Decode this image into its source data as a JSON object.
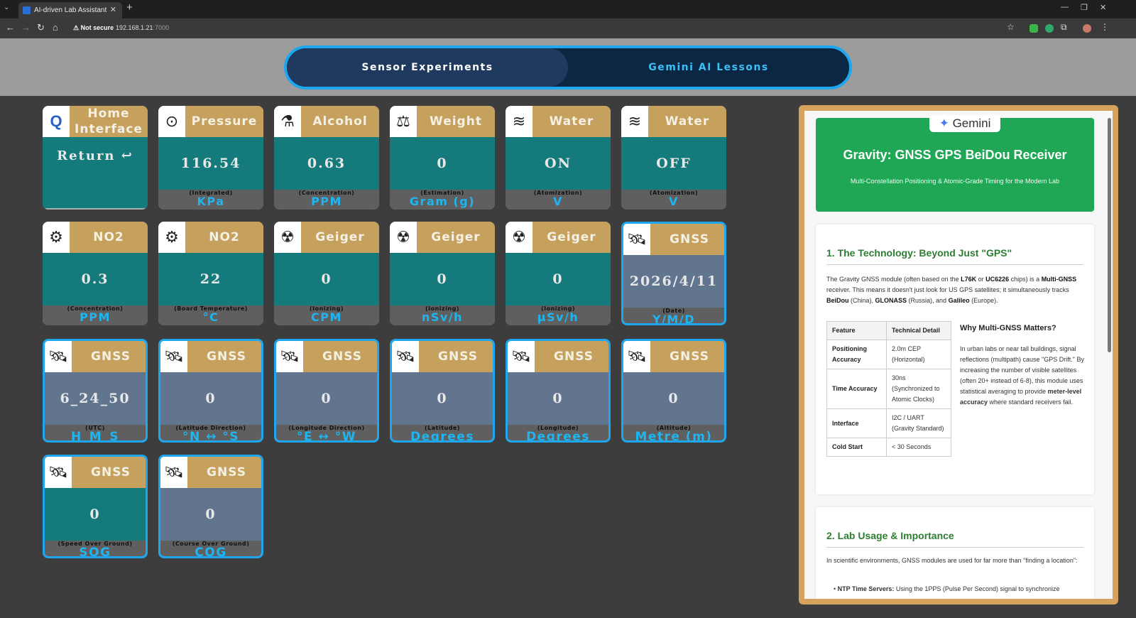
{
  "browser": {
    "tab_title": "AI-driven Lab Assistant",
    "tab_close": "✕",
    "new_tab": "+",
    "not_secure": "Not secure",
    "url_host": "192.168.1.21",
    "url_port": ":7000"
  },
  "switcher": {
    "left_label": "Sensor Experiments",
    "right_label": "Gemini AI Lessons"
  },
  "cards": [
    {
      "title": "Home Interface",
      "value": "Return ↩",
      "desc": "",
      "unit": ""
    },
    {
      "title": "Pressure",
      "value": "116.54",
      "desc": "(Integrated)",
      "unit": "KPa"
    },
    {
      "title": "Alcohol",
      "value": "0.63",
      "desc": "(Concentration)",
      "unit": "PPM"
    },
    {
      "title": "Weight",
      "value": "0",
      "desc": "(Estimation)",
      "unit": "Gram (g)"
    },
    {
      "title": "Water",
      "value": "ON",
      "desc": "(Atomization)",
      "unit": "V"
    },
    {
      "title": "Water",
      "value": "OFF",
      "desc": "(Atomization)",
      "unit": "V"
    },
    {
      "title": "NO2",
      "value": "0.3",
      "desc": "(Concentration)",
      "unit": "PPM"
    },
    {
      "title": "NO2",
      "value": "22",
      "desc": "(Board Temperature)",
      "unit": "°C"
    },
    {
      "title": "Geiger",
      "value": "0",
      "desc": "(Ionizing)",
      "unit": "CPM"
    },
    {
      "title": "Geiger",
      "value": "0",
      "desc": "(Ionizing)",
      "unit": "nSv/h"
    },
    {
      "title": "Geiger",
      "value": "0",
      "desc": "(Ionizing)",
      "unit": "μSv/h"
    },
    {
      "title": "GNSS",
      "value": "2026/4/11",
      "desc": "(Date)",
      "unit": "Y/M/D"
    },
    {
      "title": "GNSS",
      "value": "6_24_50",
      "desc": "(UTC)",
      "unit": "H_M_S"
    },
    {
      "title": "GNSS",
      "value": "0",
      "desc": "(Latitude Direction)",
      "unit": "°N ↔ °S"
    },
    {
      "title": "GNSS",
      "value": "0",
      "desc": "(Longitude Direction)",
      "unit": "°E ↔ °W"
    },
    {
      "title": "GNSS",
      "value": "0",
      "desc": "(Latitude)",
      "unit": "Degrees"
    },
    {
      "title": "GNSS",
      "value": "0",
      "desc": "(Longitude)",
      "unit": "Degrees"
    },
    {
      "title": "GNSS",
      "value": "0",
      "desc": "(Altitude)",
      "unit": "Metre (m)"
    },
    {
      "title": "GNSS",
      "value": "0",
      "desc": "(Speed Over Ground)",
      "unit": "SOG"
    },
    {
      "title": "GNSS",
      "value": "0",
      "desc": "(Course Over Ground)",
      "unit": "COG"
    }
  ],
  "lesson": {
    "logo": "Gemini",
    "title": "Gravity: GNSS GPS BeiDou Receiver",
    "subtitle": "Multi-Constellation Positioning & Atomic-Grade Timing for the Modern Lab",
    "s1_heading": "1. The Technology: Beyond Just \"GPS\"",
    "s1_text": "The Gravity GNSS module (often based on the L76K or UC6226 chips) is a Multi-GNSS receiver. This means it doesn't just look for US GPS satellites; it simultaneously tracks BeiDou (China), GLONASS (Russia), and Galileo (Europe).",
    "table_headers": [
      "Feature",
      "Technical Detail"
    ],
    "table_rows": [
      {
        "feature": "Positioning Accuracy",
        "detail": "2.0m CEP (Horizontal)"
      },
      {
        "feature": "Time Accuracy",
        "detail": "30ns (Synchronized to Atomic Clocks)"
      },
      {
        "feature": "Interface",
        "detail": "I2C / UART (Gravity Standard)"
      },
      {
        "feature": "Cold Start",
        "detail": "< 30 Seconds"
      }
    ],
    "why_heading": "Why Multi-GNSS Matters?",
    "why_text": "In urban labs or near tall buildings, signal reflections (multipath) cause \"GPS Drift.\" By increasing the number of visible satellites (often 20+ instead of 6-8), this module uses statistical averaging to provide meter-level accuracy where standard receivers fail.",
    "s2_heading": "2. Lab Usage & Importance",
    "s2_text": "In scientific environments, GNSS modules are used for far more than \"finding a location\":",
    "bullet_label": "NTP Time Servers:",
    "bullet_text": "Using the 1PPS (Pulse Per Second) signal to synchronize"
  },
  "icons": {
    "home": "qualcomm-logo-icon",
    "pressure": "pressure-gauge-icon",
    "alcohol": "lab-flask-icon",
    "weight": "scale-icon",
    "water": "mist-icon",
    "no2": "no2-gear-icon",
    "geiger": "geiger-counter-icon",
    "gnss": "satellite-icon"
  },
  "colors": {
    "accent_blue": "#1ea7ee",
    "card_header": "#c6a15e",
    "teal": "#147a7c",
    "slate": "#62758f",
    "gemini_green": "#1fa755",
    "frame_gold": "#d6a35e"
  }
}
